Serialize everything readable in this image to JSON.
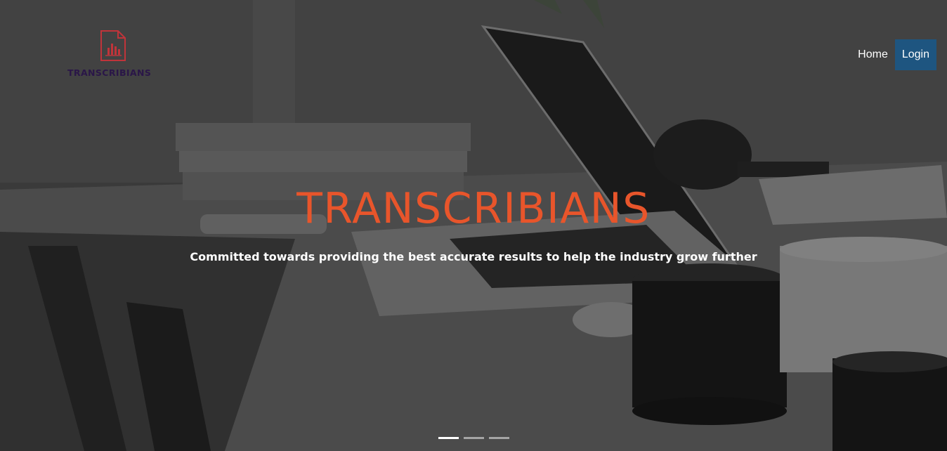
{
  "brand": {
    "logo_text": "TRANSCRIBIANS",
    "logo_icon": "document-chart-icon",
    "logo_color": "#2a1648",
    "logo_accent": "#c0343a"
  },
  "nav": {
    "home_label": "Home",
    "login_label": "Login",
    "login_bg": "#1e5580"
  },
  "hero": {
    "title": "TRANSCRIBIANS",
    "subtitle": "Committed towards providing the best accurate results to help the industry grow further",
    "title_color": "#e8552b"
  },
  "carousel": {
    "slide_count": 3,
    "active_index": 0
  }
}
